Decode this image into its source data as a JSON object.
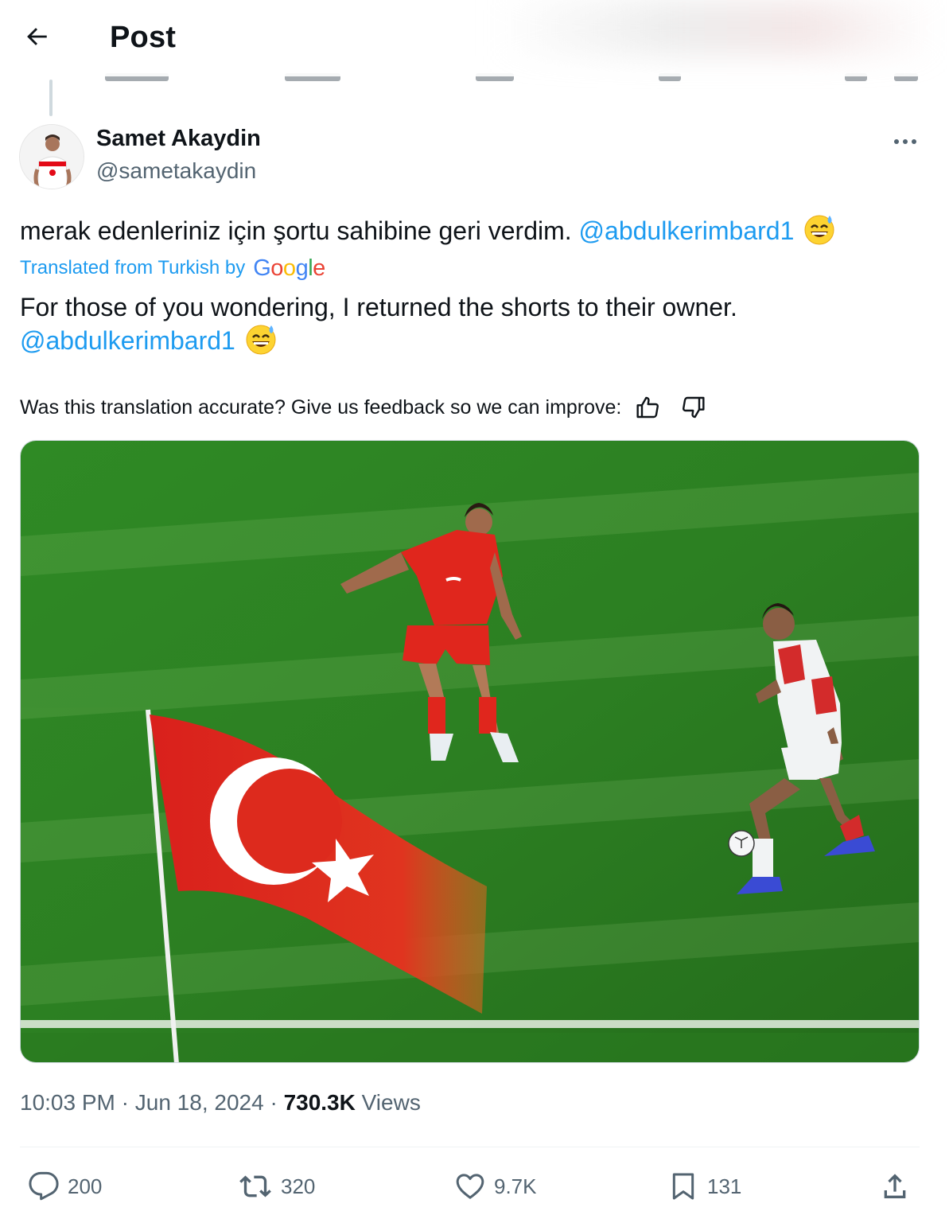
{
  "header": {
    "back_icon": "arrow-left-icon",
    "title": "Post"
  },
  "author": {
    "name": "Samet Akaydin",
    "handle": "@sametakaydin",
    "more_icon": "more-horizontal-icon"
  },
  "post": {
    "text": "merak edenleriniz için şortu sahibine geri verdim.",
    "mention": "@abdulkerimbard1",
    "emoji": "😅"
  },
  "translation": {
    "label": "Translated from Turkish by",
    "provider": "Google",
    "text": "For those of you wondering, I returned the shorts to their owner.",
    "mention": "@abdulkerimbard1",
    "emoji": "😅"
  },
  "feedback": {
    "prompt": "Was this translation accurate? Give us feedback so we can improve:",
    "thumbs_up_icon": "thumbs-up-icon",
    "thumbs_down_icon": "thumbs-down-icon"
  },
  "media": {
    "alt": "photo-football-players-turkish-flag"
  },
  "meta": {
    "time": "10:03 PM",
    "separator": "·",
    "date": "Jun 18, 2024",
    "views_count": "730.3K",
    "views_label": "Views"
  },
  "actions": {
    "replies": "200",
    "reposts": "320",
    "likes": "9.7K",
    "bookmarks": "131"
  },
  "colors": {
    "accent": "#1d9bf0",
    "secondary_text": "#536471",
    "primary_text": "#0f1419",
    "divider": "#eff3f4"
  }
}
